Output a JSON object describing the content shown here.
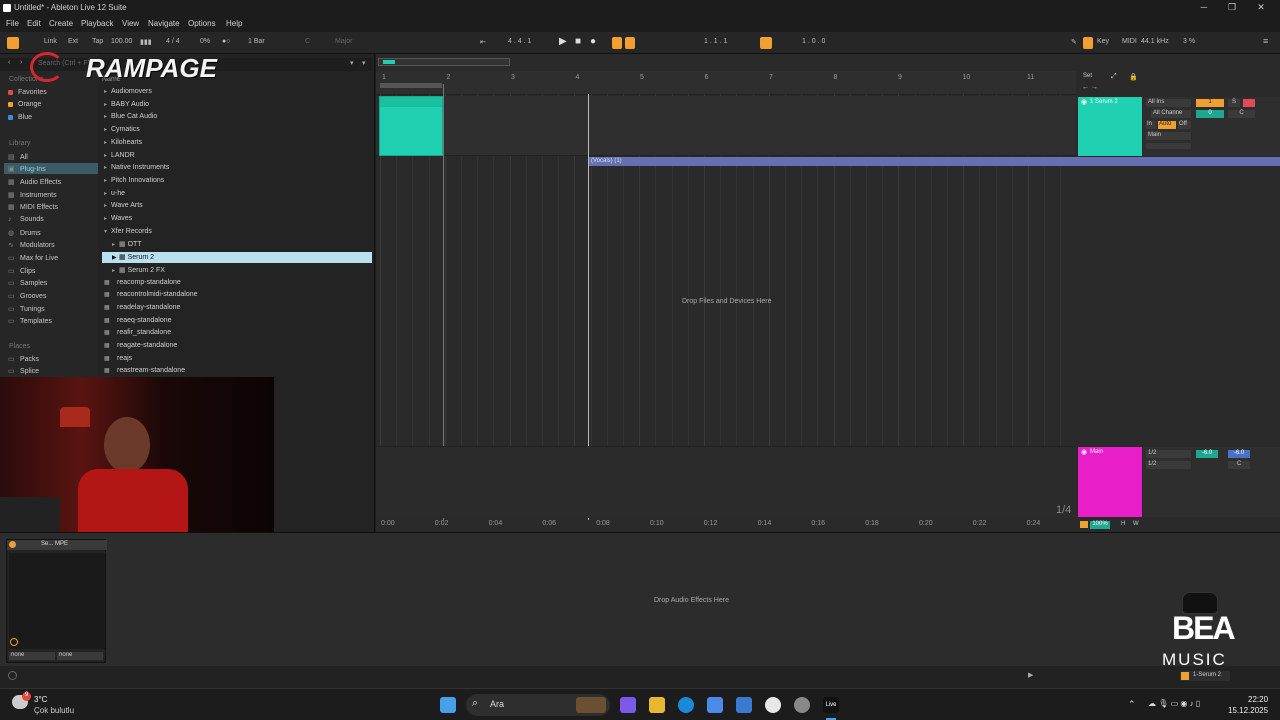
{
  "window": {
    "title": "Untitled* - Ableton Live 12 Suite",
    "min": "─",
    "max": "❐",
    "close": "✕"
  },
  "menu": [
    "File",
    "Edit",
    "Create",
    "Playback",
    "View",
    "Navigate",
    "Options",
    "Help"
  ],
  "control": {
    "link": "Link",
    "ext": "Ext",
    "tap": "Tap",
    "tempo": "100.00",
    "sig": "4 / 4",
    "swing": "0%",
    "quant": "1 Bar",
    "key": "C",
    "scale": "Major",
    "pos": "4 .  4 .  1",
    "pos2": "1 .  1 .  1",
    "pos3": "1 .  0 .  0",
    "key_btn": "Key",
    "midi_btn": "MIDI",
    "rate": "44.1 kHz",
    "cpu": "3 %"
  },
  "overlay": {
    "rampage": "RAMPAGE",
    "search_placeholder": "Search (Ctrl + F)"
  },
  "browser": {
    "collections_label": "Collections",
    "collections": [
      {
        "label": "Favorites",
        "color": "#e04a3f"
      },
      {
        "label": "Orange",
        "color": "#f0a030"
      },
      {
        "label": "Blue",
        "color": "#3a8fd8"
      }
    ],
    "library_label": "Library",
    "library": [
      "All",
      "Plug-Ins",
      "Audio Effects",
      "Instruments",
      "MIDI Effects",
      "Sounds",
      "Drums",
      "Modulators",
      "Max for Live",
      "Clips",
      "Samples",
      "Grooves",
      "Tunings",
      "Templates"
    ],
    "places_label": "Places",
    "places": [
      "Packs",
      "Splice"
    ],
    "name_header": "Name",
    "tree": [
      {
        "label": "Audiomovers",
        "type": "folder"
      },
      {
        "label": "BABY Audio",
        "type": "folder"
      },
      {
        "label": "Blue Cat Audio",
        "type": "folder"
      },
      {
        "label": "Cymatics",
        "type": "folder"
      },
      {
        "label": "Kilohearts",
        "type": "folder"
      },
      {
        "label": "LANDR",
        "type": "folder"
      },
      {
        "label": "Native Instruments",
        "type": "folder"
      },
      {
        "label": "Pitch Innovations",
        "type": "folder"
      },
      {
        "label": "u-he",
        "type": "folder"
      },
      {
        "label": "Wave Arts",
        "type": "folder"
      },
      {
        "label": "Waves",
        "type": "folder"
      },
      {
        "label": "Xfer Records",
        "type": "open"
      },
      {
        "label": "OTT",
        "type": "plugin-child"
      },
      {
        "label": "Serum 2",
        "type": "plugin-child-selected"
      },
      {
        "label": "Serum 2 FX",
        "type": "plugin-child"
      },
      {
        "label": "reacomp-standalone",
        "type": "plugin"
      },
      {
        "label": "reacontrolmidi-standalone",
        "type": "plugin"
      },
      {
        "label": "readelay-standalone",
        "type": "plugin"
      },
      {
        "label": "reaeq-standalone",
        "type": "plugin"
      },
      {
        "label": "reafir_standalone",
        "type": "plugin"
      },
      {
        "label": "reagate-standalone",
        "type": "plugin"
      },
      {
        "label": "reajs",
        "type": "plugin"
      },
      {
        "label": "reastream-standalone",
        "type": "plugin"
      }
    ]
  },
  "arrangement": {
    "bars": [
      "1",
      "2",
      "3",
      "4",
      "5",
      "6",
      "7",
      "8",
      "9",
      "10",
      "11"
    ],
    "times": [
      "0:00",
      "0:02",
      "0:04",
      "0:06",
      "0:08",
      "0:10",
      "0:12",
      "0:14",
      "0:16",
      "0:18",
      "0:20",
      "0:22",
      "0:24"
    ],
    "locator": "(Vocals) (1)",
    "drop_files": "Drop Files and Devices Here",
    "zoom": "1/4",
    "set_label": "Set"
  },
  "tracks": {
    "serum": {
      "name": "1 Serum 2",
      "input": "All Ins",
      "channel": "All Channe",
      "monitor_in": "In",
      "monitor_auto": "Auto",
      "monitor_off": "Off",
      "output": "Main",
      "num": "1",
      "solo": "S",
      "vol": "0",
      "pan": "C",
      "color": "#1fd1b0"
    },
    "main": {
      "name": "Main",
      "out1": "1/2",
      "out2": "1/2",
      "vol": "-6.0",
      "vol2": "-6.0",
      "pan": "C",
      "color": "#e81fc8",
      "zoom_pct": "100%",
      "h": "H",
      "w": "W"
    }
  },
  "detail": {
    "device": "Se... MPE",
    "drop_fx": "Drop Audio Effects Here",
    "none1": "none",
    "none2": "none"
  },
  "status": {
    "track": "1-Serum 2"
  },
  "bea": {
    "line1": "BEA",
    "line2": "MUSIC"
  },
  "taskbar": {
    "temp": "3°C",
    "weather": "Çok bulutlu",
    "search": "Ara",
    "time": "22:20",
    "date": "15.12.2025",
    "badge": "9"
  }
}
